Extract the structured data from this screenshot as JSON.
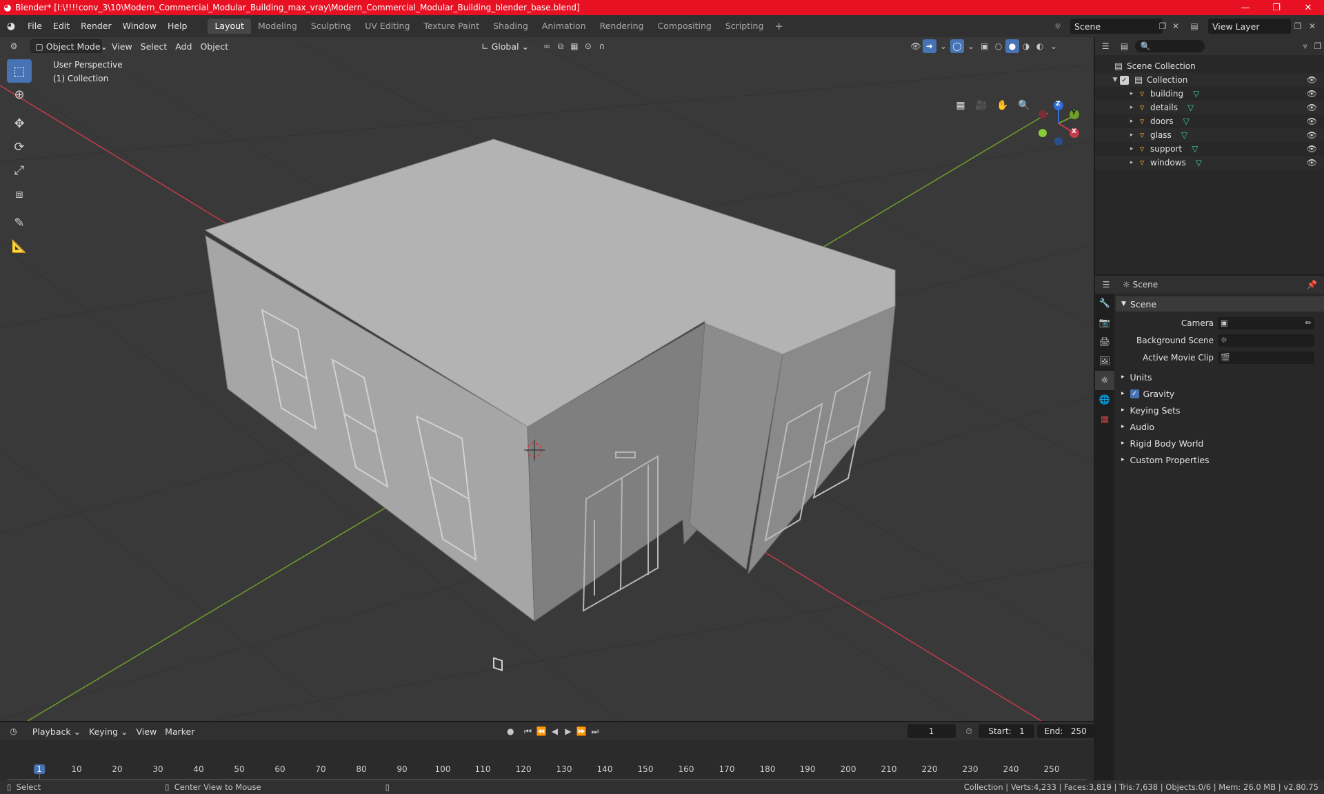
{
  "window": {
    "title": "Blender* [I:\\!!!!conv_3\\10\\Modern_Commercial_Modular_Building_max_vray\\Modern_Commercial_Modular_Building_blender_base.blend]",
    "minimize": "—",
    "maximize": "❐",
    "close": "✕"
  },
  "menus": [
    "File",
    "Edit",
    "Render",
    "Window",
    "Help"
  ],
  "workspaces": [
    "Layout",
    "Modeling",
    "Sculpting",
    "UV Editing",
    "Texture Paint",
    "Shading",
    "Animation",
    "Rendering",
    "Compositing",
    "Scripting"
  ],
  "workspace_add": "+",
  "scene": {
    "name": "Scene",
    "view_layer": "View Layer"
  },
  "viewport": {
    "mode": "Object Mode",
    "menus": [
      "View",
      "Select",
      "Add",
      "Object"
    ],
    "orientation": "Global",
    "overlay_lines": [
      "User Perspective",
      "(1) Collection"
    ],
    "gizmo": {
      "x": "X",
      "y": "Y",
      "z": "Z"
    },
    "colors": {
      "x_axis": "#c43b4b",
      "y_axis": "#6f9f2a",
      "z_axis": "#2f6fd6",
      "bg": "#393939",
      "active": "#4772b3"
    }
  },
  "tools": [
    "select-box",
    "cursor",
    "move",
    "rotate",
    "scale",
    "transform",
    "annotate",
    "measure"
  ],
  "outliner": {
    "search_placeholder": "",
    "root": "Scene Collection",
    "collection": "Collection",
    "objects": [
      "building",
      "details",
      "doors",
      "glass",
      "support",
      "windows"
    ]
  },
  "properties": {
    "context": "Scene",
    "panel": "Scene",
    "fields": [
      {
        "label": "Camera",
        "value": ""
      },
      {
        "label": "Background Scene",
        "value": ""
      },
      {
        "label": "Active Movie Clip",
        "value": ""
      }
    ],
    "subpanels": [
      "Units",
      "Gravity",
      "Keying Sets",
      "Audio",
      "Rigid Body World",
      "Custom Properties"
    ],
    "gravity_checked": true
  },
  "timeline": {
    "menus": [
      "Playback",
      "Keying",
      "View",
      "Marker"
    ],
    "current_frame": "1",
    "start_label": "Start:",
    "start": "1",
    "end_label": "End:",
    "end": "250",
    "ruler": [
      "1",
      "10",
      "20",
      "30",
      "40",
      "50",
      "60",
      "70",
      "80",
      "90",
      "100",
      "110",
      "120",
      "130",
      "140",
      "150",
      "160",
      "170",
      "180",
      "190",
      "200",
      "210",
      "220",
      "230",
      "240",
      "250"
    ]
  },
  "status": {
    "left_action": "Select",
    "mid_action": "Center View to Mouse",
    "stats": "Collection | Verts:4,233 | Faces:3,819 | Tris:7,638 | Objects:0/6 | Mem: 26.0 MB | v2.80.75"
  }
}
